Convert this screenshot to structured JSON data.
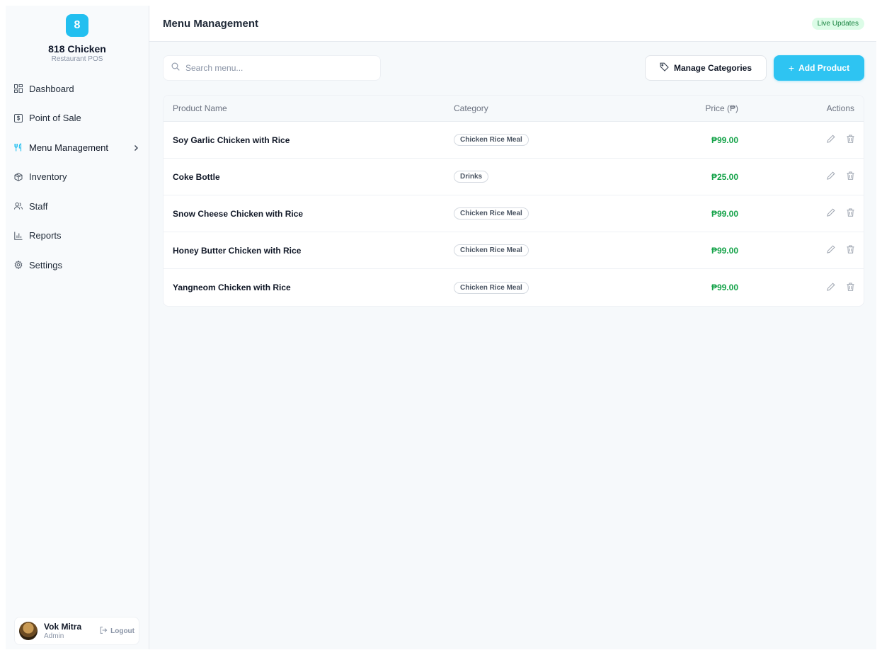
{
  "sidebar": {
    "logo_letter": "8",
    "brand_name": "818 Chicken",
    "brand_sub": "Restaurant POS",
    "items": [
      {
        "label": "Dashboard",
        "icon": "grid-icon"
      },
      {
        "label": "Point of Sale",
        "icon": "dollar-icon"
      },
      {
        "label": "Menu Management",
        "icon": "utensils-icon",
        "active": true
      },
      {
        "label": "Inventory",
        "icon": "box-icon"
      },
      {
        "label": "Staff",
        "icon": "users-icon"
      },
      {
        "label": "Reports",
        "icon": "bar-chart-icon"
      },
      {
        "label": "Settings",
        "icon": "gear-icon"
      }
    ],
    "user": {
      "name": "Vok Mitra",
      "role": "Admin",
      "logout_label": "Logout"
    }
  },
  "header": {
    "title": "Menu Management",
    "live_badge": "Live Updates"
  },
  "toolbar": {
    "search_placeholder": "Search menu...",
    "manage_categories_label": "Manage Categories",
    "add_product_label": "Add Product"
  },
  "table": {
    "columns": {
      "name": "Product Name",
      "category": "Category",
      "price": "Price (₱)",
      "actions": "Actions"
    },
    "rows": [
      {
        "name": "Soy Garlic Chicken with Rice",
        "category": "Chicken Rice Meal",
        "price": "₱99.00"
      },
      {
        "name": "Coke Bottle",
        "category": "Drinks",
        "price": "₱25.00"
      },
      {
        "name": "Snow Cheese Chicken with Rice",
        "category": "Chicken Rice Meal",
        "price": "₱99.00"
      },
      {
        "name": "Honey Butter Chicken with Rice",
        "category": "Chicken Rice Meal",
        "price": "₱99.00"
      },
      {
        "name": "Yangneom Chicken with Rice",
        "category": "Chicken Rice Meal",
        "price": "₱99.00"
      }
    ]
  },
  "colors": {
    "accent": "#22bff0",
    "price": "#16a34a",
    "live": "#15803d"
  }
}
